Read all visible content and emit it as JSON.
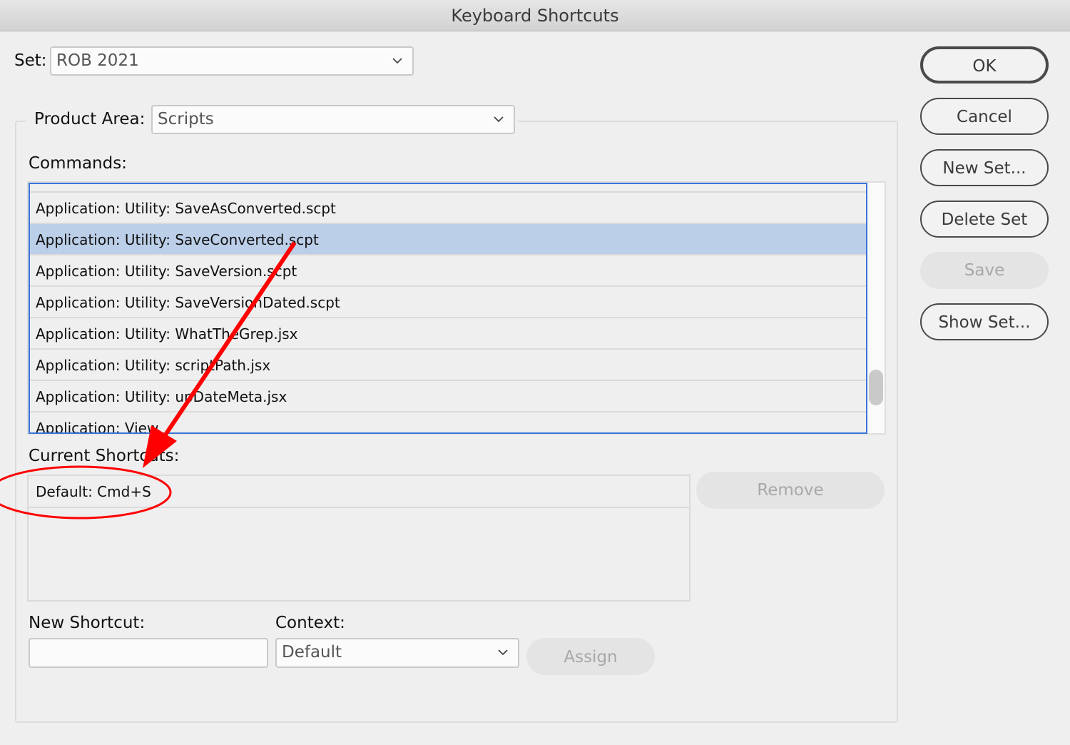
{
  "window": {
    "title": "Keyboard Shortcuts"
  },
  "set": {
    "label": "Set:",
    "value": "ROB 2021"
  },
  "product_area": {
    "label": "Product Area:",
    "value": "Scripts"
  },
  "commands": {
    "label": "Commands:",
    "items": [
      {
        "label": "Application: Utility: SaveAsConverted.scpt",
        "selected": false
      },
      {
        "label": "Application: Utility: SaveConverted.scpt",
        "selected": true
      },
      {
        "label": "Application: Utility: SaveVersion.scpt",
        "selected": false
      },
      {
        "label": "Application: Utility: SaveVersionDated.scpt",
        "selected": false
      },
      {
        "label": "Application: Utility: WhatTheGrep.jsx",
        "selected": false
      },
      {
        "label": "Application: Utility: scriptPath.jsx",
        "selected": false
      },
      {
        "label": "Application: Utility: upDateMeta.jsx",
        "selected": false
      },
      {
        "label": "Application: View",
        "selected": false
      }
    ]
  },
  "current_shortcuts": {
    "label": "Current Shortcuts:",
    "items": [
      "Default: Cmd+S"
    ],
    "remove_label": "Remove"
  },
  "new_shortcut": {
    "label": "New Shortcut:",
    "value": "",
    "placeholder": ""
  },
  "context": {
    "label": "Context:",
    "value": "Default"
  },
  "assign_label": "Assign",
  "buttons": {
    "ok": "OK",
    "cancel": "Cancel",
    "new_set": "New Set...",
    "delete_set": "Delete Set",
    "save": "Save",
    "show_set": "Show Set..."
  },
  "annotation": {
    "color": "#ff0000"
  }
}
